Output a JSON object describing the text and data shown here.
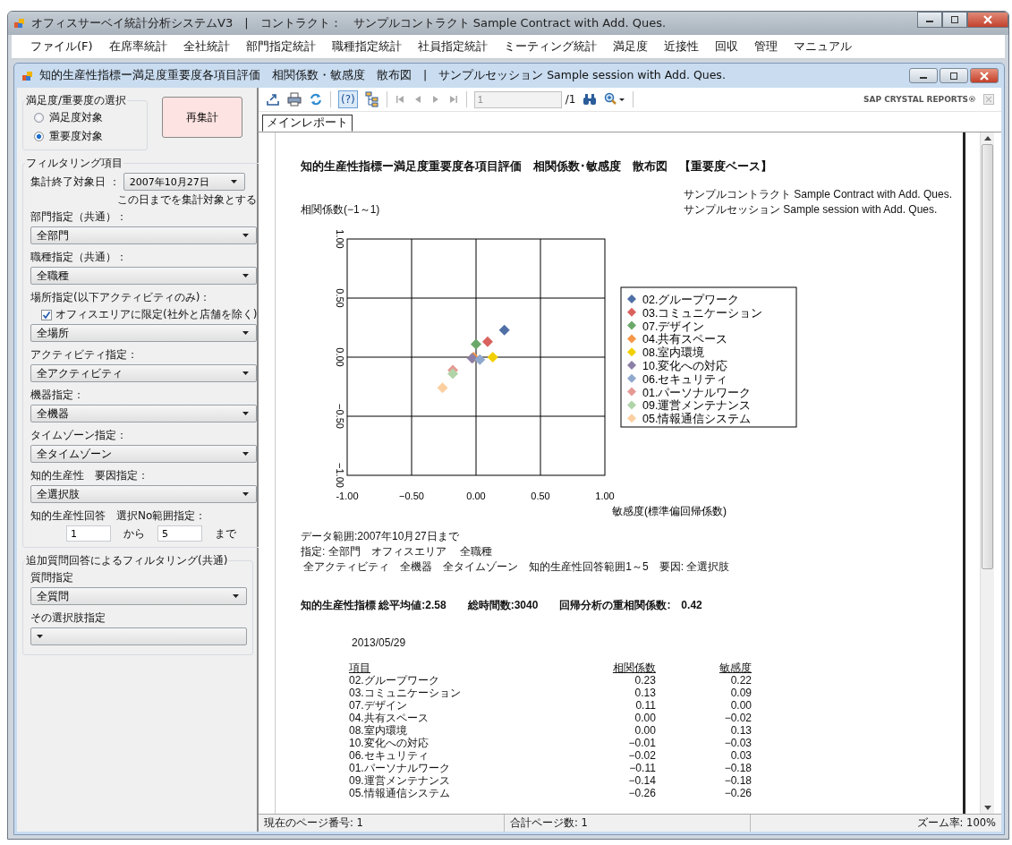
{
  "window": {
    "title": "オフィスサーベイ統計分析システムV3　|　コントラクト：　サンプルコントラクト Sample Contract with Add. Ques."
  },
  "menu": [
    "ファイル(F)",
    "在席率統計",
    "全社統計",
    "部門指定統計",
    "職種指定統計",
    "社員指定統計",
    "ミーティング統計",
    "満足度",
    "近接性",
    "回収",
    "管理",
    "マニュアル"
  ],
  "child_window": {
    "title": "知的生産性指標ー満足度重要度各項目評価　相関係数・敏感度　散布図　|　サンプルセッション Sample session with Add. Ques."
  },
  "selection_group": {
    "label": "満足度/重要度の選択",
    "options": [
      {
        "label": "満足度対象",
        "selected": false
      },
      {
        "label": "重要度対象",
        "selected": true
      }
    ]
  },
  "recalc_button": "再集計",
  "filter_group": {
    "label": "フィルタリング項目",
    "items": [
      {
        "kind": "date",
        "label": "集計終了対象日 ：",
        "value": "2007年10月27日",
        "note": "この日までを集計対象とする"
      },
      {
        "kind": "dropdown",
        "label": "部門指定（共通）：",
        "value": "全部門"
      },
      {
        "kind": "dropdown",
        "label": "職種指定（共通）：",
        "value": "全職種"
      },
      {
        "kind": "checkdrop",
        "label": "場所指定(以下アクティビティのみ)：",
        "checkbox": {
          "label": "オフィスエリアに限定(社外と店舗を除く)",
          "checked": true
        },
        "value": "全場所"
      },
      {
        "kind": "dropdown",
        "label": "アクティビティ指定：",
        "value": "全アクティビティ"
      },
      {
        "kind": "dropdown",
        "label": "機器指定：",
        "value": "全機器"
      },
      {
        "kind": "dropdown",
        "label": "タイムゾーン指定：",
        "value": "全タイムゾーン"
      },
      {
        "kind": "dropdown",
        "label": "知的生産性　要因指定：",
        "value": "全選択肢"
      },
      {
        "kind": "range",
        "label": "知的生産性回答　選択No範囲指定：",
        "from": "1",
        "between": "から",
        "to": "5",
        "suffix": "まで"
      }
    ]
  },
  "extra_group": {
    "label": "追加質問回答によるフィルタリング(共通)",
    "items": [
      {
        "kind": "dropdown",
        "label": "質問指定",
        "value": "全質問"
      },
      {
        "kind": "dropdown",
        "label": "その選択肢指定"
      }
    ]
  },
  "viewer": {
    "help_glyph": "(?)",
    "page_field": "1",
    "page_total": "/1",
    "brand": "SAP CRYSTAL REPORTS®",
    "tabs": [
      {
        "label": "メインレポート",
        "selected": true
      }
    ],
    "status": [
      "現在のページ番号: 1",
      "合計ページ数: 1",
      "ズーム率: 100%"
    ]
  },
  "report": {
    "title": "知的生産性指標ー満足度重要度各項目評価　相関係数･敏感度　散布図　【重要度ベース】",
    "contract_lines": [
      "サンプルコントラクト  Sample Contract with Add. Ques.",
      "サンプルセッション Sample session with Add. Ques."
    ],
    "chart_data": {
      "type": "scatter",
      "grid": true,
      "legend": true,
      "xlabel": "敏感度(標準偏回帰係数)",
      "ylabel": "相関係数(−1～1)",
      "xlim": [
        -1,
        1
      ],
      "ylim": [
        -1,
        1
      ],
      "xticks": [
        {
          "value": -1,
          "label": "-1.00"
        },
        {
          "value": -0.5,
          "label": "−0.50"
        },
        {
          "value": 0,
          "label": "0.00"
        },
        {
          "value": 0.5,
          "label": "0.50"
        },
        {
          "value": 1,
          "label": "1.00"
        }
      ],
      "yticks": [
        {
          "value": 1,
          "label": "1.00"
        },
        {
          "value": 0.5,
          "label": "0.50"
        },
        {
          "value": 0,
          "label": "0.00"
        },
        {
          "value": -0.5,
          "label": "−0.50"
        },
        {
          "value": -1,
          "label": "−1.00"
        }
      ],
      "series": [
        {
          "name": "02.グループワーク",
          "color": "#4f6fa6",
          "x": [
            0.22
          ],
          "values": [
            0.23
          ]
        },
        {
          "name": "03.コミュニケーション",
          "color": "#d9625e",
          "x": [
            0.09
          ],
          "values": [
            0.13
          ]
        },
        {
          "name": "07.デザイン",
          "color": "#6aa86a",
          "x": [
            0.0
          ],
          "values": [
            0.11
          ]
        },
        {
          "name": "04.共有スペース",
          "color": "#f79646",
          "x": [
            -0.02
          ],
          "values": [
            0.0
          ]
        },
        {
          "name": "08.室内環境",
          "color": "#f2d000",
          "x": [
            0.13
          ],
          "values": [
            0.0
          ]
        },
        {
          "name": "10.変化への対応",
          "color": "#8c7fa6",
          "x": [
            -0.03
          ],
          "values": [
            -0.01
          ]
        },
        {
          "name": "06.セキュリティ",
          "color": "#8fa8cc",
          "x": [
            0.03
          ],
          "values": [
            -0.02
          ]
        },
        {
          "name": "01.パーソナルワーク",
          "color": "#e59a94",
          "x": [
            -0.18
          ],
          "values": [
            -0.11
          ]
        },
        {
          "name": "09.運営メンテナンス",
          "color": "#b0d4a8",
          "x": [
            -0.18
          ],
          "values": [
            -0.14
          ]
        },
        {
          "name": "05.情報通信システム",
          "color": "#fbcfa0",
          "x": [
            -0.26
          ],
          "values": [
            -0.26
          ]
        }
      ]
    },
    "data_lines": [
      "データ範囲:2007年10月27日まで",
      "指定: 全部門　オフィスエリア　 全職種",
      " 全アクティビティ　全機器　全タイムゾーン　知的生産性回答範囲1～5　要因: 全選択肢"
    ],
    "summary": "知的生産性指標 総平均値:2.58　　総時間数:3040　　回帰分析の重相関係数:　0.42",
    "date": "2013/05/29",
    "table": {
      "columns": [
        "項目",
        "相関係数",
        "敏感度"
      ],
      "rows": [
        [
          "02.グループワーク",
          "0.23",
          "0.22"
        ],
        [
          "03.コミュニケーション",
          "0.13",
          "0.09"
        ],
        [
          "07.デザイン",
          "0.11",
          "0.00"
        ],
        [
          "04.共有スペース",
          "0.00",
          "−0.02"
        ],
        [
          "08.室内環境",
          "0.00",
          "0.13"
        ],
        [
          "10.変化への対応",
          "−0.01",
          "−0.03"
        ],
        [
          "06.セキュリティ",
          "−0.02",
          "0.03"
        ],
        [
          "01.パーソナルワーク",
          "−0.11",
          "−0.18"
        ],
        [
          "09.運営メンテナンス",
          "−0.14",
          "−0.18"
        ],
        [
          "05.情報通信システム",
          "−0.26",
          "−0.26"
        ]
      ]
    }
  }
}
